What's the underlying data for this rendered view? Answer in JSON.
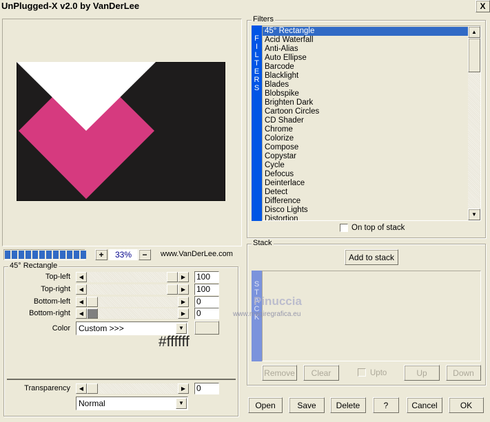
{
  "window": {
    "title": "UnPlugged-X v2.0 by VanDerLee",
    "close_label": "X"
  },
  "preview": {
    "zoom": "33%",
    "plus": "+",
    "minus": "−",
    "website": "www.VanDerLee.com",
    "progress_percent": 100,
    "colors": {
      "background": "#1e1c1c",
      "triangle": "#ffffff",
      "diamond": "#d63a7f"
    }
  },
  "params": {
    "group_title": "45° Rectangle",
    "rows": [
      {
        "label": "Top-left",
        "value": "100",
        "percent": 100
      },
      {
        "label": "Top-right",
        "value": "100",
        "percent": 100
      },
      {
        "label": "Bottom-left",
        "value": "0",
        "percent": 0
      },
      {
        "label": "Bottom-right",
        "value": "0",
        "percent": 0
      }
    ],
    "color_label": "Color",
    "color_select": "Custom >>>",
    "color_hex": "#ffffff",
    "transparency_label": "Transparency",
    "transparency_value": "0",
    "blend_mode": "Normal"
  },
  "filters": {
    "group_title": "Filters",
    "strip_label": "FILTERS",
    "items": [
      "45° Rectangle",
      "Acid Waterfall",
      "Anti-Alias",
      "Auto Ellipse",
      "Barcode",
      "Blacklight",
      "Blades",
      "Blobspike",
      "Brighten Dark",
      "Cartoon Circles",
      "CD Shader",
      "Chrome",
      "Colorize",
      "Compose",
      "Copystar",
      "Cycle",
      "Defocus",
      "Deinterlace",
      "Detect",
      "Difference",
      "Disco Lights",
      "Distortion"
    ],
    "selected": "45° Rectangle",
    "on_top_label": "On top of stack",
    "on_top_checked": false
  },
  "stack": {
    "group_title": "Stack",
    "strip_label": "STACK",
    "add_label": "Add to stack",
    "remove_label": "Remove",
    "clear_label": "Clear",
    "upto_label": "Upto",
    "up_label": "Up",
    "down_label": "Down"
  },
  "buttons": {
    "open": "Open",
    "save": "Save",
    "delete": "Delete",
    "help": "?",
    "cancel": "Cancel",
    "ok": "OK"
  },
  "watermark": {
    "name": "Pinuccia",
    "url": "www.magiregrafica.eu"
  }
}
